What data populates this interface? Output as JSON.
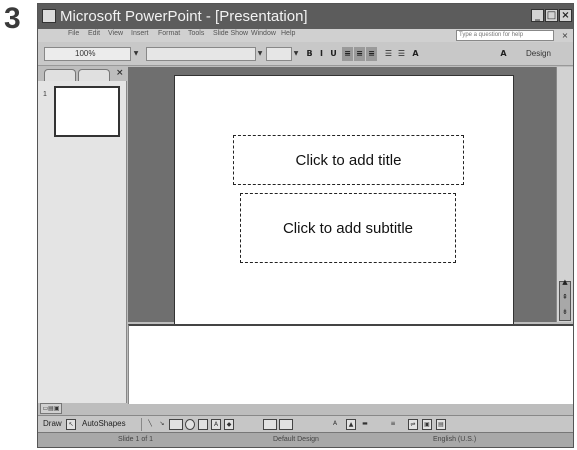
{
  "step_number": "3",
  "window": {
    "title": "Microsoft PowerPoint - [Presentation]"
  },
  "menu": {
    "items": [
      "File",
      "Edit",
      "View",
      "Insert",
      "Format",
      "Tools",
      "Slide Show",
      "Window",
      "Help"
    ],
    "help_placeholder": "Type a question for help"
  },
  "toolbar": {
    "zoom": "100%",
    "design_label": "Design"
  },
  "slides_pane": {
    "slide_number": "1"
  },
  "slide": {
    "title_placeholder": "Click to add title",
    "subtitle_placeholder": "Click to add subtitle"
  },
  "drawing_toolbar": {
    "draw_label": "Draw",
    "autoshapes_label": "AutoShapes"
  },
  "status_bar": {
    "slide_info": "Slide 1 of 1",
    "design": "Default Design",
    "language": "English (U.S.)"
  }
}
